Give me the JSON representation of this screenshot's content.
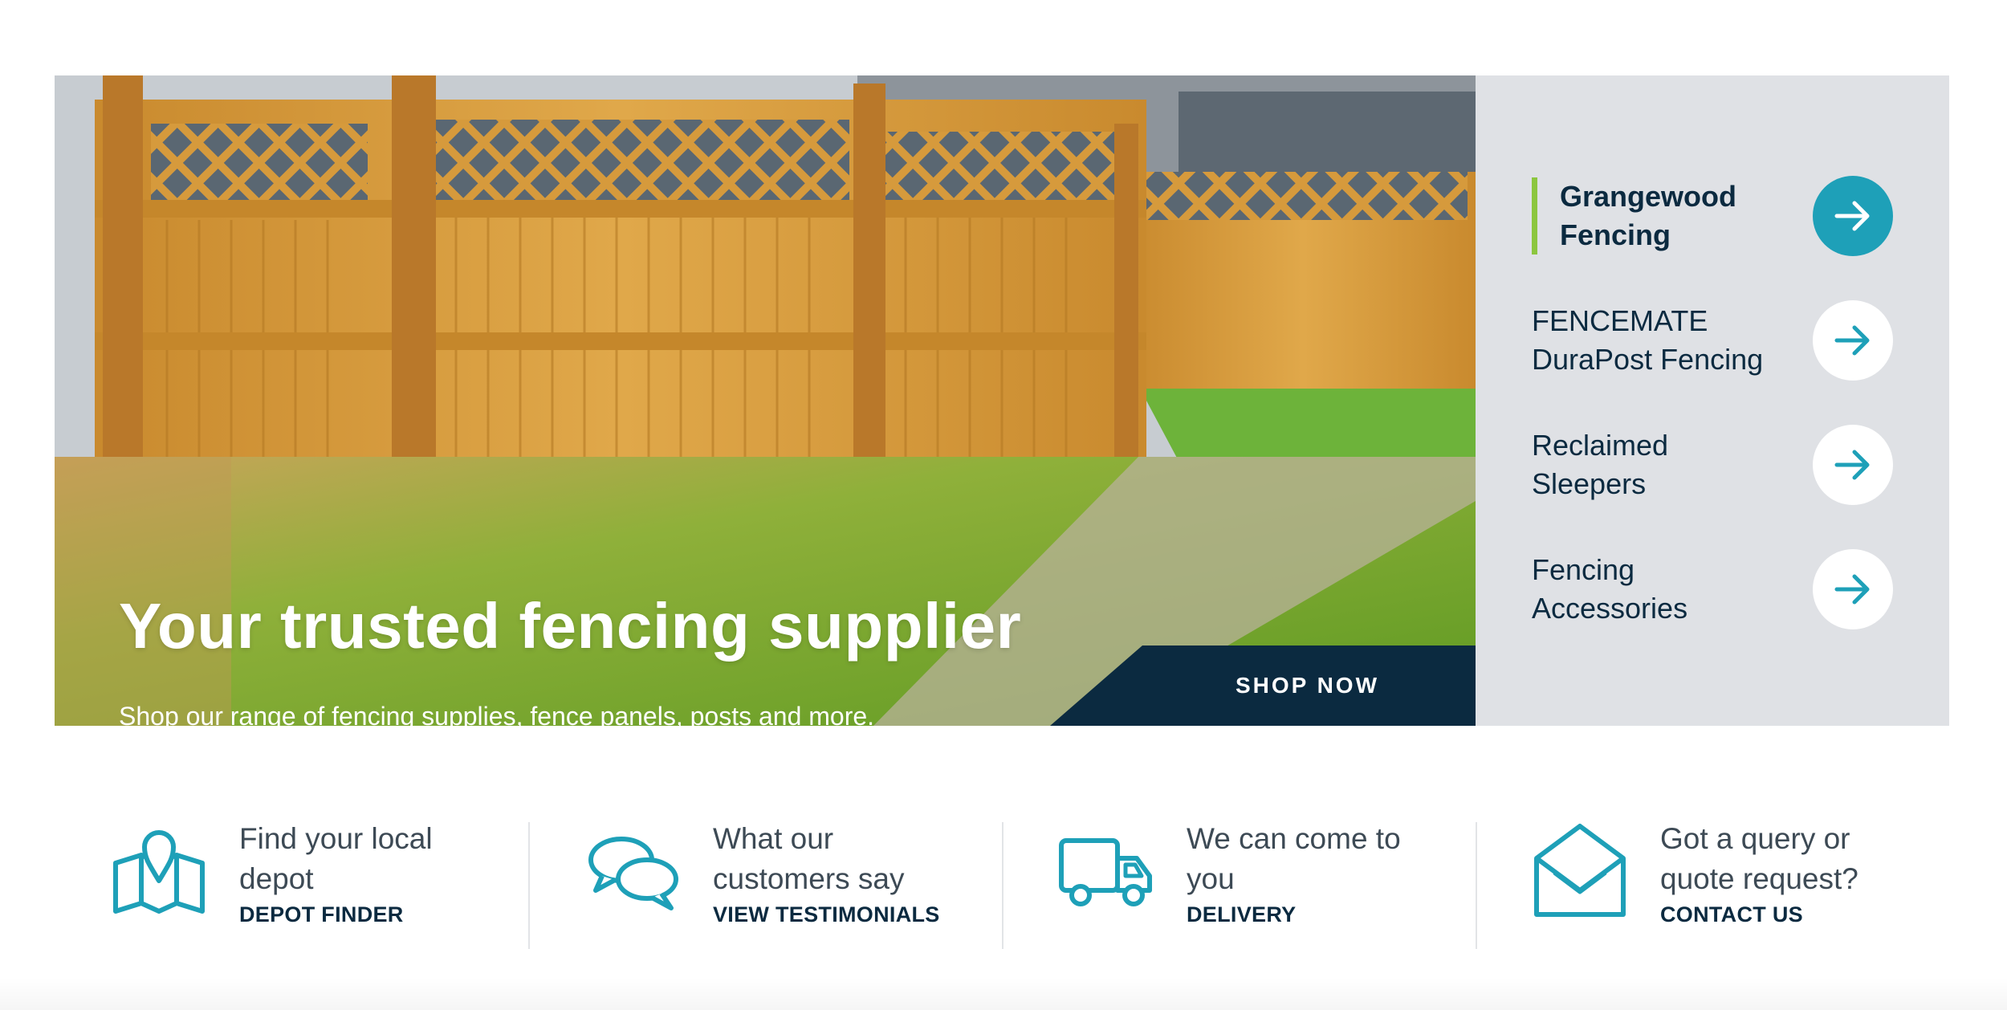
{
  "hero": {
    "headline": "Your trusted fencing supplier",
    "subtext": "Shop our range of fencing supplies, fence panels, posts and more.",
    "cta_label": "SHOP NOW"
  },
  "side_menu": {
    "items": [
      {
        "label": "Grangewood\nFencing",
        "active": true
      },
      {
        "label": "FENCEMATE\nDuraPost Fencing",
        "active": false
      },
      {
        "label": "Reclaimed\nSleepers",
        "active": false
      },
      {
        "label": "Fencing\nAccessories",
        "active": false
      }
    ]
  },
  "features": [
    {
      "icon": "map-pin-icon",
      "text": "Find your local\ndepot",
      "link": "DEPOT FINDER"
    },
    {
      "icon": "chat-bubbles-icon",
      "text": "What our\ncustomers say",
      "link": "VIEW TESTIMONIALS"
    },
    {
      "icon": "delivery-truck-icon",
      "text": "We can come to\nyou",
      "link": "DELIVERY"
    },
    {
      "icon": "envelope-icon",
      "text": "Got a query or\nquote request?",
      "link": "CONTACT US"
    }
  ],
  "colors": {
    "navy": "#0b2a40",
    "teal": "#1ea0b8",
    "green_accent": "#8cc63f",
    "panel_grey": "#dfe1e5"
  }
}
